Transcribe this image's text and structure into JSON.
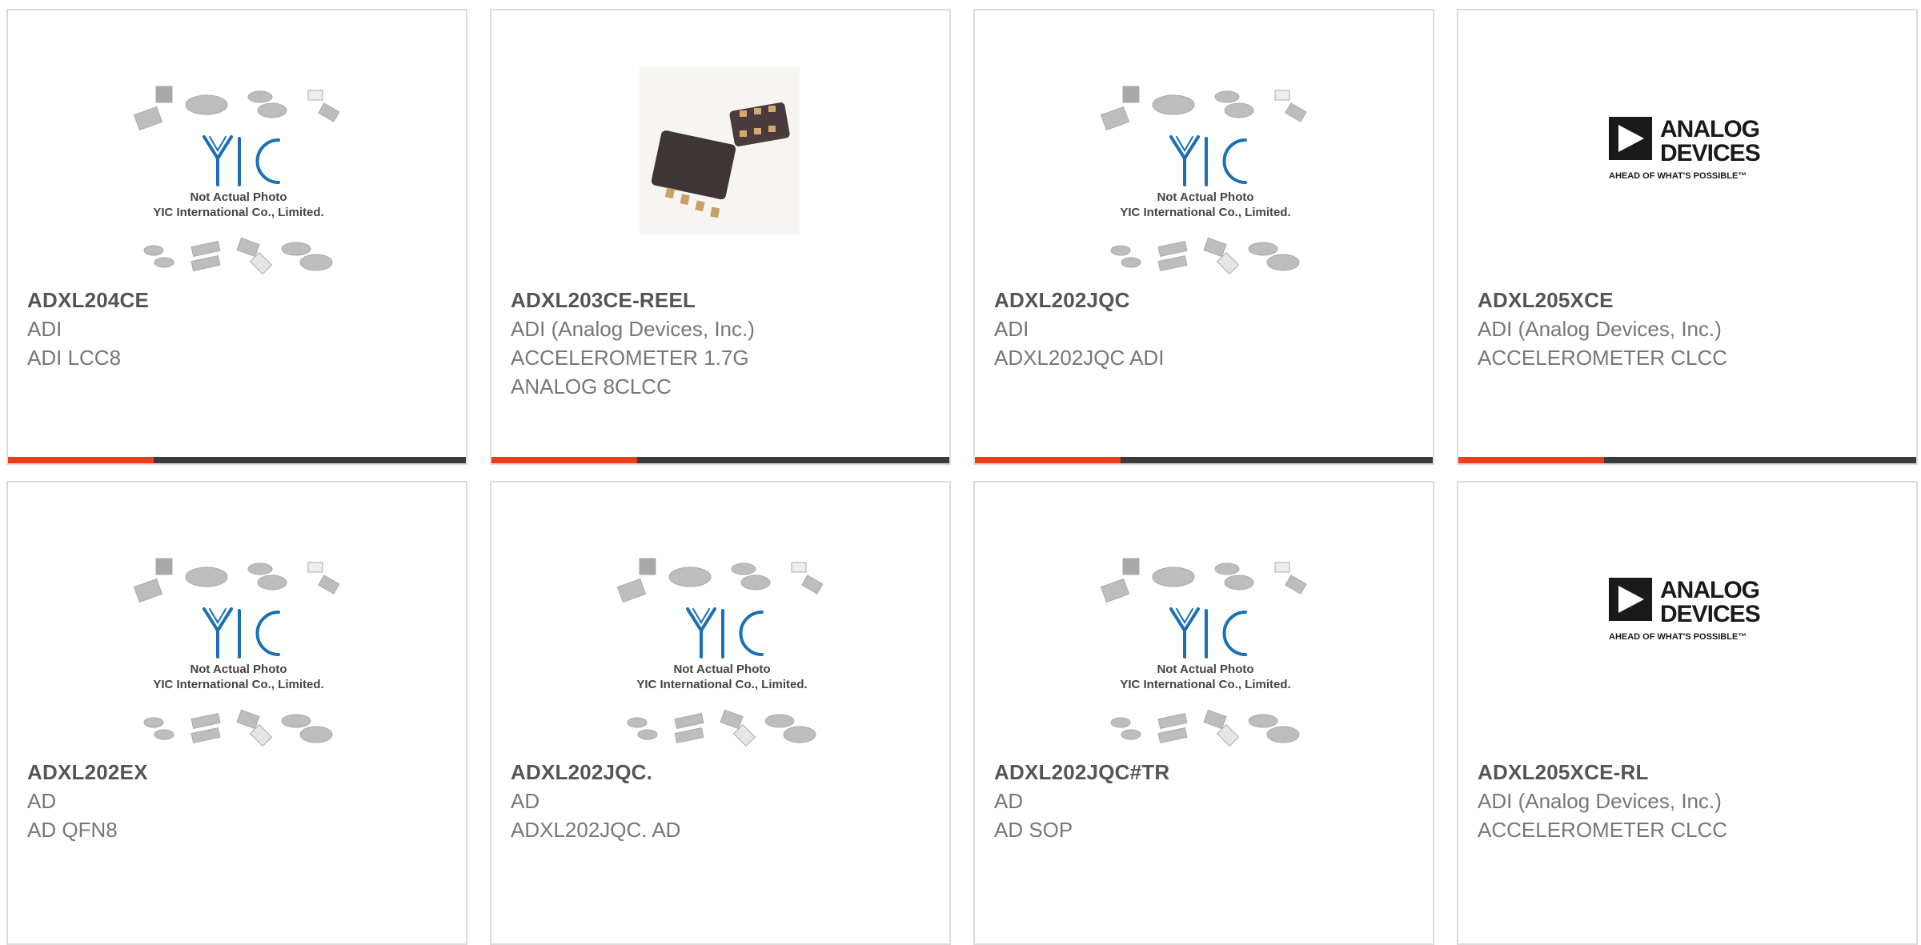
{
  "products": [
    {
      "part": "ADXL204CE",
      "maker": "ADI",
      "desc": [
        "ADI LCC8"
      ],
      "image": "yic-placeholder",
      "placeholder_text": [
        "Not Actual Photo",
        "YIC International Co., Limited."
      ]
    },
    {
      "part": "ADXL203CE-REEL",
      "maker": "ADI (Analog Devices, Inc.)",
      "desc": [
        "ACCELEROMETER 1.7G",
        "ANALOG 8CLCC"
      ],
      "image": "chip-photo"
    },
    {
      "part": "ADXL202JQC",
      "maker": "ADI",
      "desc": [
        "ADXL202JQC ADI"
      ],
      "image": "yic-placeholder",
      "placeholder_text": [
        "Not Actual Photo",
        "YIC International Co., Limited."
      ]
    },
    {
      "part": "ADXL205XCE",
      "maker": "ADI (Analog Devices, Inc.)",
      "desc": [
        "ACCELEROMETER CLCC"
      ],
      "image": "analog-devices-logo",
      "logo_text": [
        "ANALOG",
        "DEVICES",
        "AHEAD OF WHAT'S POSSIBLE™"
      ]
    },
    {
      "part": "ADXL202EX",
      "maker": "AD",
      "desc": [
        "AD QFN8"
      ],
      "image": "yic-placeholder",
      "placeholder_text": [
        "Not Actual Photo",
        "YIC International Co., Limited."
      ]
    },
    {
      "part": "ADXL202JQC.",
      "maker": "AD",
      "desc": [
        "ADXL202JQC. AD"
      ],
      "image": "yic-placeholder",
      "placeholder_text": [
        "Not Actual Photo",
        "YIC International Co., Limited."
      ]
    },
    {
      "part": "ADXL202JQC#TR",
      "maker": "AD",
      "desc": [
        "AD SOP"
      ],
      "image": "yic-placeholder",
      "placeholder_text": [
        "Not Actual Photo",
        "YIC International Co., Limited."
      ]
    },
    {
      "part": "ADXL205XCE-RL",
      "maker": "ADI (Analog Devices, Inc.)",
      "desc": [
        "ACCELEROMETER CLCC"
      ],
      "image": "analog-devices-logo",
      "logo_text": [
        "ANALOG",
        "DEVICES",
        "AHEAD OF WHAT'S POSSIBLE™"
      ]
    }
  ],
  "colors": {
    "accent": "#e8401c",
    "bar": "#3b3b3b",
    "yic_blue": "#1a6fb5",
    "text_dark": "#555555",
    "text_light": "#777777"
  }
}
